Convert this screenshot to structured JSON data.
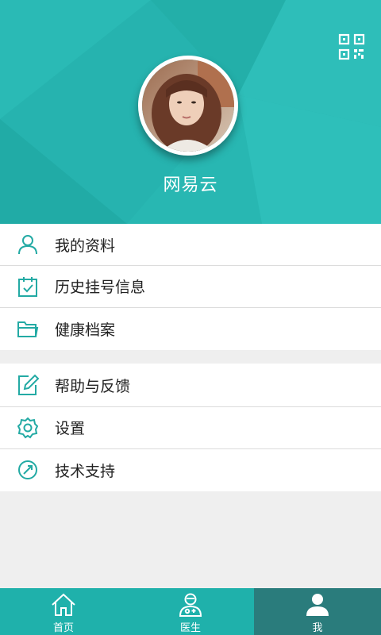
{
  "colors": {
    "primary": "#28b7b2",
    "tab_active": "#2a7c7c",
    "icon_teal": "#23aaa4"
  },
  "profile": {
    "username": "网易云",
    "avatar_icon": "user-avatar-photo",
    "qr_icon": "qr-code-icon"
  },
  "menu_primary": [
    {
      "label": "我的资料",
      "icon": "user-icon"
    },
    {
      "label": "历史挂号信息",
      "icon": "calendar-check-icon"
    },
    {
      "label": "健康档案",
      "icon": "folder-icon"
    }
  ],
  "menu_secondary": [
    {
      "label": "帮助与反馈",
      "icon": "edit-icon"
    },
    {
      "label": "设置",
      "icon": "gear-icon"
    },
    {
      "label": "技术支持",
      "icon": "compass-icon"
    }
  ],
  "tabs": [
    {
      "label": "首页",
      "icon": "home-icon"
    },
    {
      "label": "医生",
      "icon": "doctor-icon"
    },
    {
      "label": "我",
      "icon": "person-icon",
      "active": true
    }
  ]
}
